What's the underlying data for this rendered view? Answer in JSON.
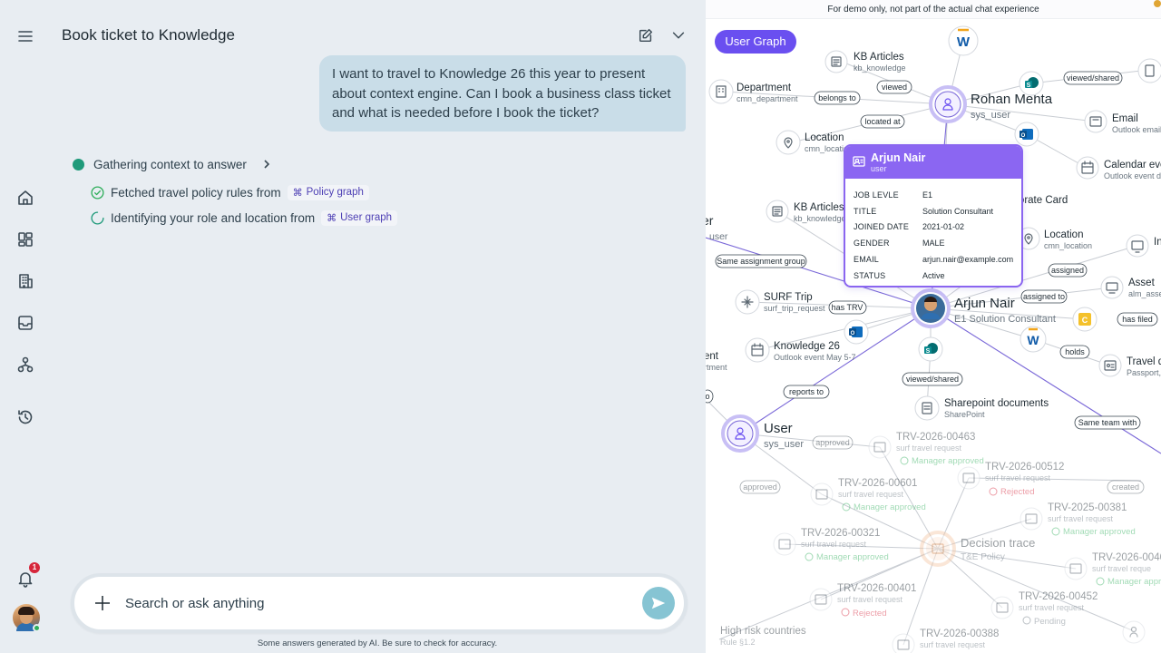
{
  "chat": {
    "title": "Book ticket to Knowledge",
    "user_message": "I want to travel to Knowledge 26 this year to present about context engine. Can I book a business class ticket and what is needed before I book the ticket?",
    "thinking_label": "Gathering context to answer",
    "steps": [
      {
        "text": "Fetched travel policy rules from",
        "chip": "Policy graph",
        "status": "done"
      },
      {
        "text": "Identifying your role and location from",
        "chip": "User graph",
        "status": "loading"
      }
    ],
    "composer_placeholder": "Search or ask anything",
    "disclaimer": "Some answers generated by AI. Be sure to check for accuracy.",
    "notification_count": "1"
  },
  "rail_icons": [
    "menu-icon",
    "home-icon",
    "dashboard-icon",
    "building-icon",
    "inbox-icon",
    "workflow-icon",
    "history-icon",
    "bell-icon"
  ],
  "graph": {
    "demo_note": "For demo only, not part of the actual chat experience",
    "pill_label": "User Graph",
    "nodes": {
      "kb_articles_top": {
        "title": "KB Articles",
        "sub": "kb_knowledge"
      },
      "department": {
        "title": "Department",
        "sub": "cmn_department"
      },
      "rohan": {
        "title": "Rohan Mehta",
        "sub": "sys_user"
      },
      "email": {
        "title": "Email",
        "sub": "Outlook email"
      },
      "location_top": {
        "title": "Location",
        "sub": "cmn_location"
      },
      "calendar": {
        "title": "Calendar event",
        "sub": "Outlook event d"
      },
      "kb_articles_mid": {
        "title": "KB Articles",
        "sub": "kb_knowledge"
      },
      "expense_card": {
        "title": "Corporate Card",
        "sub": ""
      },
      "location_mid": {
        "title": "Location",
        "sub": "cmn_location"
      },
      "in_node": {
        "title": "In",
        "sub": ""
      },
      "user_left": {
        "title": "er",
        "sub": "user"
      },
      "asset": {
        "title": "Asset",
        "sub": "alm_asset"
      },
      "surf_trip": {
        "title": "SURF Trip",
        "sub": "surf_trip_request"
      },
      "arjun": {
        "title": "Arjun Nair",
        "sub": "E1 Solution Consultant"
      },
      "knowledge26": {
        "title": "Knowledge 26",
        "sub": "Outlook event May 5-7"
      },
      "travel_doc": {
        "title": "Travel d",
        "sub": "Passport, "
      },
      "ent_node": {
        "title": "ent",
        "sub": "rtment"
      },
      "sharepoint": {
        "title": "Sharepoint documents",
        "sub": "SharePoint"
      },
      "user_bottom": {
        "title": "User",
        "sub": "sys_user"
      },
      "decision": {
        "title": "Decision trace",
        "sub": "T&E Policy"
      },
      "high_risk": {
        "title": "High risk countries",
        "sub": "Rule §1.2"
      }
    },
    "edge_labels": {
      "viewed": "viewed",
      "belongs_to": "belongs to",
      "viewed_shared_top": "viewed/shared",
      "located_at": "located at",
      "same_assignment_group": "Same assignment group",
      "assigned": "assigned",
      "assigned_to": "assigned to",
      "has_trv": "has TRV",
      "has_filed": "has filed",
      "holds": "holds",
      "viewed_shared_mid": "viewed/shared",
      "reports_to": "reports to",
      "same_team_with": "Same team with",
      "approved_1": "approved",
      "approved_2": "approved",
      "created": "created",
      "o_label": "o"
    },
    "requests": [
      {
        "id": "TRV-2026-00463",
        "type": "surf travel request",
        "status": "Manager approved"
      },
      {
        "id": "TRV-2026-00512",
        "type": "surf travel request",
        "status": "Rejected"
      },
      {
        "id": "TRV-2026-00601",
        "type": "surf travel request",
        "status": "Manager approved"
      },
      {
        "id": "TRV-2025-00381",
        "type": "surf travel request",
        "status": "Manager approved"
      },
      {
        "id": "TRV-2026-00321",
        "type": "surf travel request",
        "status": "Manager approved"
      },
      {
        "id": "TRV-2026-0040",
        "type": "surf travel reque",
        "status": "Manager approv"
      },
      {
        "id": "TRV-2026-00401",
        "type": "surf travel request",
        "status": "Rejected"
      },
      {
        "id": "TRV-2026-00452",
        "type": "surf travel request",
        "status": "Pending"
      },
      {
        "id": "TRV-2026-00388",
        "type": "surf travel request",
        "status": ""
      }
    ]
  },
  "profile_card": {
    "name": "Arjun Nair",
    "type": "user",
    "rows": [
      {
        "key": "JOB LEVLE",
        "value": "E1"
      },
      {
        "key": "TITLE",
        "value": "Solution Consultant"
      },
      {
        "key": "JOINED DATE",
        "value": "2021-01-02"
      },
      {
        "key": "GENDER",
        "value": "MALE"
      },
      {
        "key": "EMAIL",
        "value": "arjun.nair@example.com"
      },
      {
        "key": "STATUS",
        "value": "Active"
      }
    ]
  },
  "colors": {
    "accent": "#6a4ff0",
    "card_header": "#8b66f2",
    "send_button": "#86c4d3",
    "status_green": "#2fae5b",
    "status_red": "#d6263b",
    "edge_purple": "#7a68d8"
  }
}
